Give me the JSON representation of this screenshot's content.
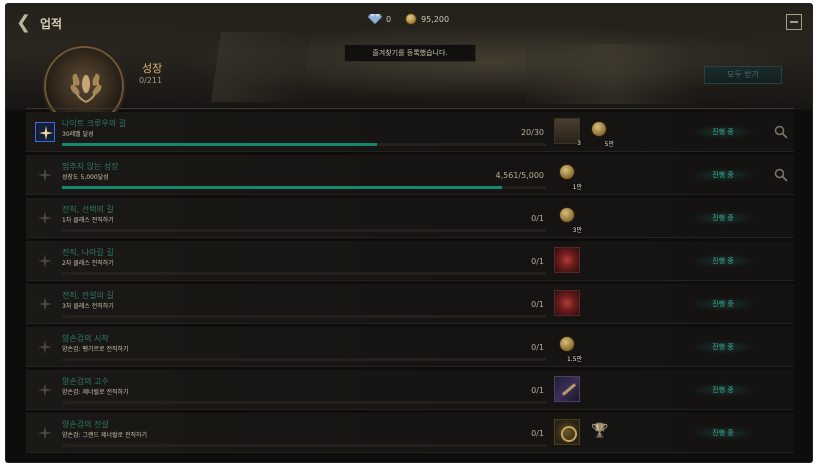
{
  "header": {
    "back_icon": "chevron-left-icon",
    "title": "업적",
    "gems": "0",
    "gold": "95,200",
    "exit_icon": "exit-icon"
  },
  "category": {
    "title": "성장",
    "progress": "0/211",
    "emblem_icon": "laurel-wreath-icon"
  },
  "toast": "즐겨찾기를 등록했습니다.",
  "claim_all_label": "모두 받기",
  "achievements": [
    {
      "name": "나이트 크루우의 길",
      "desc": "30레벨 달성",
      "progress": "20/30",
      "fill": 0.65,
      "status": "진행 중",
      "selected": true,
      "search": true,
      "rewards": [
        {
          "type": "box",
          "qty": "3"
        },
        {
          "type": "coin",
          "qty": "5만"
        }
      ]
    },
    {
      "name": "멈추지 않는 성장",
      "desc": "성장도 5,000달성",
      "progress": "4,561/5,000",
      "fill": 0.91,
      "status": "진행 중",
      "selected": false,
      "search": true,
      "rewards": [
        {
          "type": "coin",
          "qty": "1만"
        }
      ]
    },
    {
      "name": "전직, 선택의 길",
      "desc": "1차 클래스 전직하기",
      "progress": "0/1",
      "fill": 0,
      "status": "진행 중",
      "selected": false,
      "search": false,
      "rewards": [
        {
          "type": "coin",
          "qty": "3만"
        }
      ]
    },
    {
      "name": "전직, 나아갈 길",
      "desc": "2차 클래스 전직하기",
      "progress": "0/1",
      "fill": 0,
      "status": "진행 중",
      "selected": false,
      "search": false,
      "rewards": [
        {
          "type": "gem",
          "qty": ""
        }
      ]
    },
    {
      "name": "전직, 전설의 길",
      "desc": "3차 클래스 전직하기",
      "progress": "0/1",
      "fill": 0,
      "status": "진행 중",
      "selected": false,
      "search": false,
      "rewards": [
        {
          "type": "gem",
          "qty": ""
        }
      ]
    },
    {
      "name": "양손검의 시작",
      "desc": "양손검: 팽기르로 전직하기",
      "progress": "0/1",
      "fill": 0,
      "status": "진행 중",
      "selected": false,
      "search": false,
      "rewards": [
        {
          "type": "coin",
          "qty": "1.5만"
        }
      ]
    },
    {
      "name": "양손검의 고수",
      "desc": "양손검: 제너럴로 전직하기",
      "progress": "0/1",
      "fill": 0,
      "status": "진행 중",
      "selected": false,
      "search": false,
      "rewards": [
        {
          "type": "dagger",
          "qty": ""
        }
      ]
    },
    {
      "name": "양손검의 전설",
      "desc": "양손검: 그랜드 제너럴로 전직하기",
      "progress": "0/1",
      "fill": 0,
      "status": "진행 중",
      "selected": false,
      "search": false,
      "rewards": [
        {
          "type": "orb",
          "qty": ""
        },
        {
          "type": "trophy",
          "qty": ""
        }
      ]
    }
  ]
}
